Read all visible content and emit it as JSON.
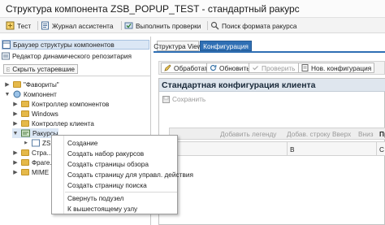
{
  "window": {
    "title": "Структура компонента ZSB_POPUP_TEST - стандартный ракурс"
  },
  "toolbar": {
    "items": [
      {
        "label": "Тест",
        "icon": "test-icon"
      },
      {
        "label": "Журнал ассистента",
        "icon": "journal-icon"
      },
      {
        "label": "Выполнить проверки",
        "icon": "run-checks-icon"
      },
      {
        "label": "Поиск формата ракурса",
        "icon": "search-icon"
      }
    ]
  },
  "left": {
    "browser_label": "Браузер структуры компонентов",
    "repo_label": "Редактор динамического репозитария",
    "hide_button": "Скрыть устаревшие"
  },
  "tree": {
    "nodes": [
      {
        "label": "\"Фавориты\""
      },
      {
        "label": "Компонент"
      },
      {
        "label": "Контроллер компонентов"
      },
      {
        "label": "Windows"
      },
      {
        "label": "Контроллер клиента"
      },
      {
        "label": "Ракурсы"
      },
      {
        "label": "ZSB..."
      },
      {
        "label": "Стра..."
      },
      {
        "label": "Фраге..."
      },
      {
        "label": "MIME"
      }
    ]
  },
  "context_menu": {
    "items": [
      "Создание",
      "Создать набор ракурсов",
      "Создать страницы обзора",
      "Создать страницу для управл. действия",
      "Создать страницу поиска",
      "Свернуть подузел",
      "К вышестоящему узлу"
    ]
  },
  "right": {
    "tabs": [
      "Структура View",
      "Конфигурация"
    ],
    "buttons": [
      "Обработать",
      "Обновить",
      "Проверить",
      "Нов. конфигурация"
    ],
    "panel_title": "Стандартная конфигурация клиента",
    "save_label": "Сохранить",
    "grid_toolbar": [
      "Добавить легенду",
      "Добав. строку",
      "Вверх",
      "Вниз",
      "Пр"
    ],
    "grid_columns": [
      "B",
      "C"
    ]
  },
  "colors": {
    "accent_tab": "#2f6fb4",
    "panel_header": "#dfe6ee",
    "folder": "#e5b94a"
  }
}
